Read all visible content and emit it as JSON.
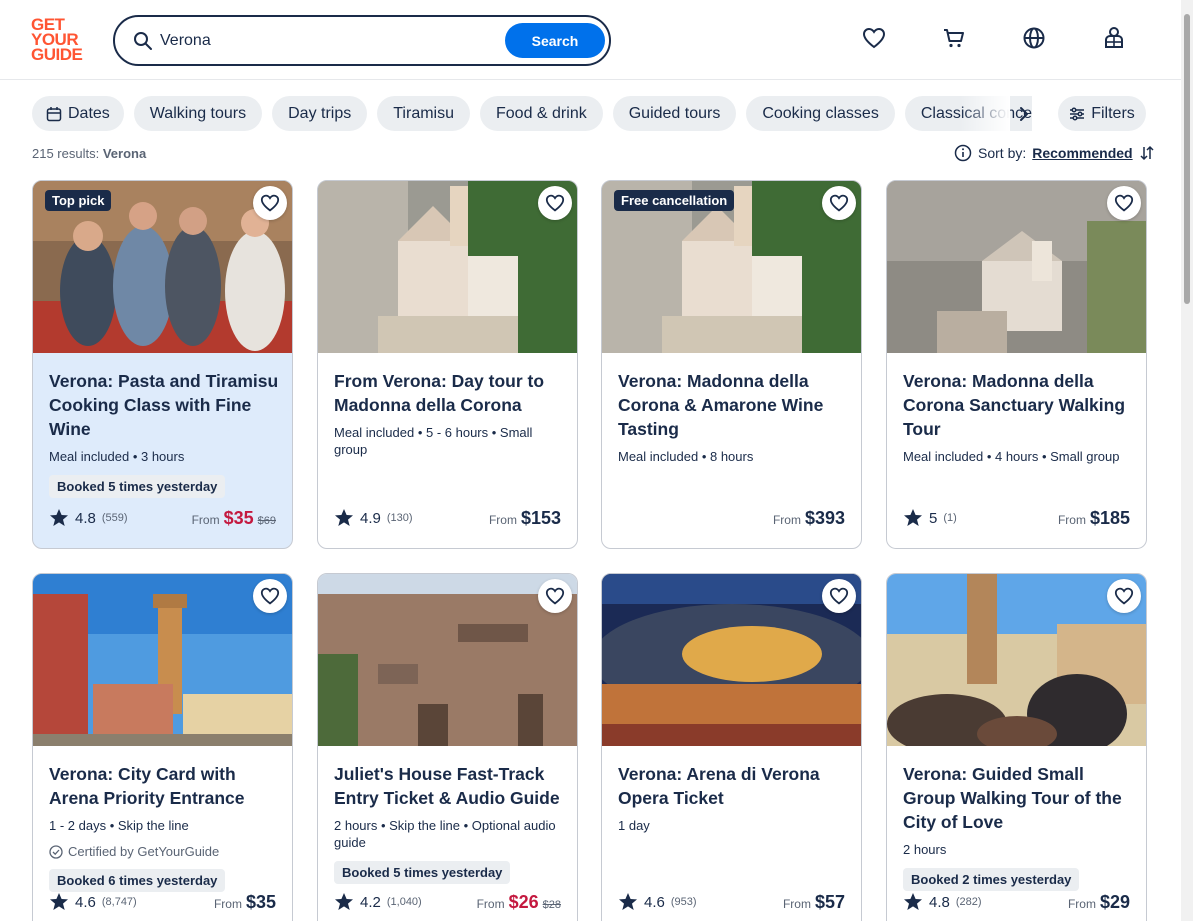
{
  "header": {
    "logo_lines": [
      "GET",
      "YOUR",
      "GUIDE"
    ],
    "search_value": "Verona",
    "search_button": "Search",
    "icons": [
      "heart-icon",
      "cart-icon",
      "globe-icon",
      "profile-icon"
    ]
  },
  "chips": [
    "Dates",
    "Walking tours",
    "Day trips",
    "Tiramisu",
    "Food & drink",
    "Guided tours",
    "Cooking classes",
    "Classical concerts"
  ],
  "filters_label": "Filters",
  "results": {
    "count": "215 results:",
    "query": "Verona"
  },
  "sort": {
    "label": "Sort by:",
    "value": "Recommended"
  },
  "colors": {
    "brand": "#ff5533",
    "primary": "#0071eb",
    "sale": "#c4193f",
    "navy": "#1a2b49"
  },
  "cards": [
    {
      "badge": "Top pick",
      "title": "Verona: Pasta and Tiramisu Cooking Class with Fine Wine",
      "meta": "Meal included • 3 hours",
      "booked": "Booked 5 times yesterday",
      "rating": "4.8",
      "reviews": "(559)",
      "from": "From",
      "price": "$35",
      "old_price": "$69"
    },
    {
      "title": "From Verona: Day tour to Madonna della Corona",
      "meta": "Meal included • 5 - 6 hours • Small group",
      "rating": "4.9",
      "reviews": "(130)",
      "from": "From",
      "price": "$153"
    },
    {
      "badge": "Free cancellation",
      "title": "Verona: Madonna della Corona & Amarone Wine Tasting",
      "meta": "Meal included • 8 hours",
      "from": "From",
      "price": "$393"
    },
    {
      "title": "Verona: Madonna della Corona Sanctuary Walking Tour",
      "meta": "Meal included • 4 hours • Small group",
      "rating": "5",
      "reviews": "(1)",
      "from": "From",
      "price": "$185"
    },
    {
      "title": "Verona: City Card with Arena Priority Entrance",
      "meta": "1 - 2 days • Skip the line",
      "cert": "Certified by GetYourGuide",
      "booked": "Booked 6 times yesterday",
      "rating": "4.6",
      "reviews": "(8,747)",
      "from": "From",
      "price": "$35"
    },
    {
      "title": "Juliet's House Fast-Track Entry Ticket & Audio Guide",
      "meta": "2 hours • Skip the line • Optional audio guide",
      "booked": "Booked 5 times yesterday",
      "rating": "4.2",
      "reviews": "(1,040)",
      "from": "From",
      "price": "$26",
      "old_price": "$28"
    },
    {
      "title": "Verona: Arena di Verona Opera Ticket",
      "meta": "1 day",
      "rating": "4.6",
      "reviews": "(953)",
      "from": "From",
      "price": "$57"
    },
    {
      "title": "Verona: Guided Small Group Walking Tour of the City of Love",
      "meta": "2 hours",
      "booked": "Booked 2 times yesterday",
      "rating": "4.8",
      "reviews": "(282)",
      "from": "From",
      "price": "$29"
    }
  ]
}
